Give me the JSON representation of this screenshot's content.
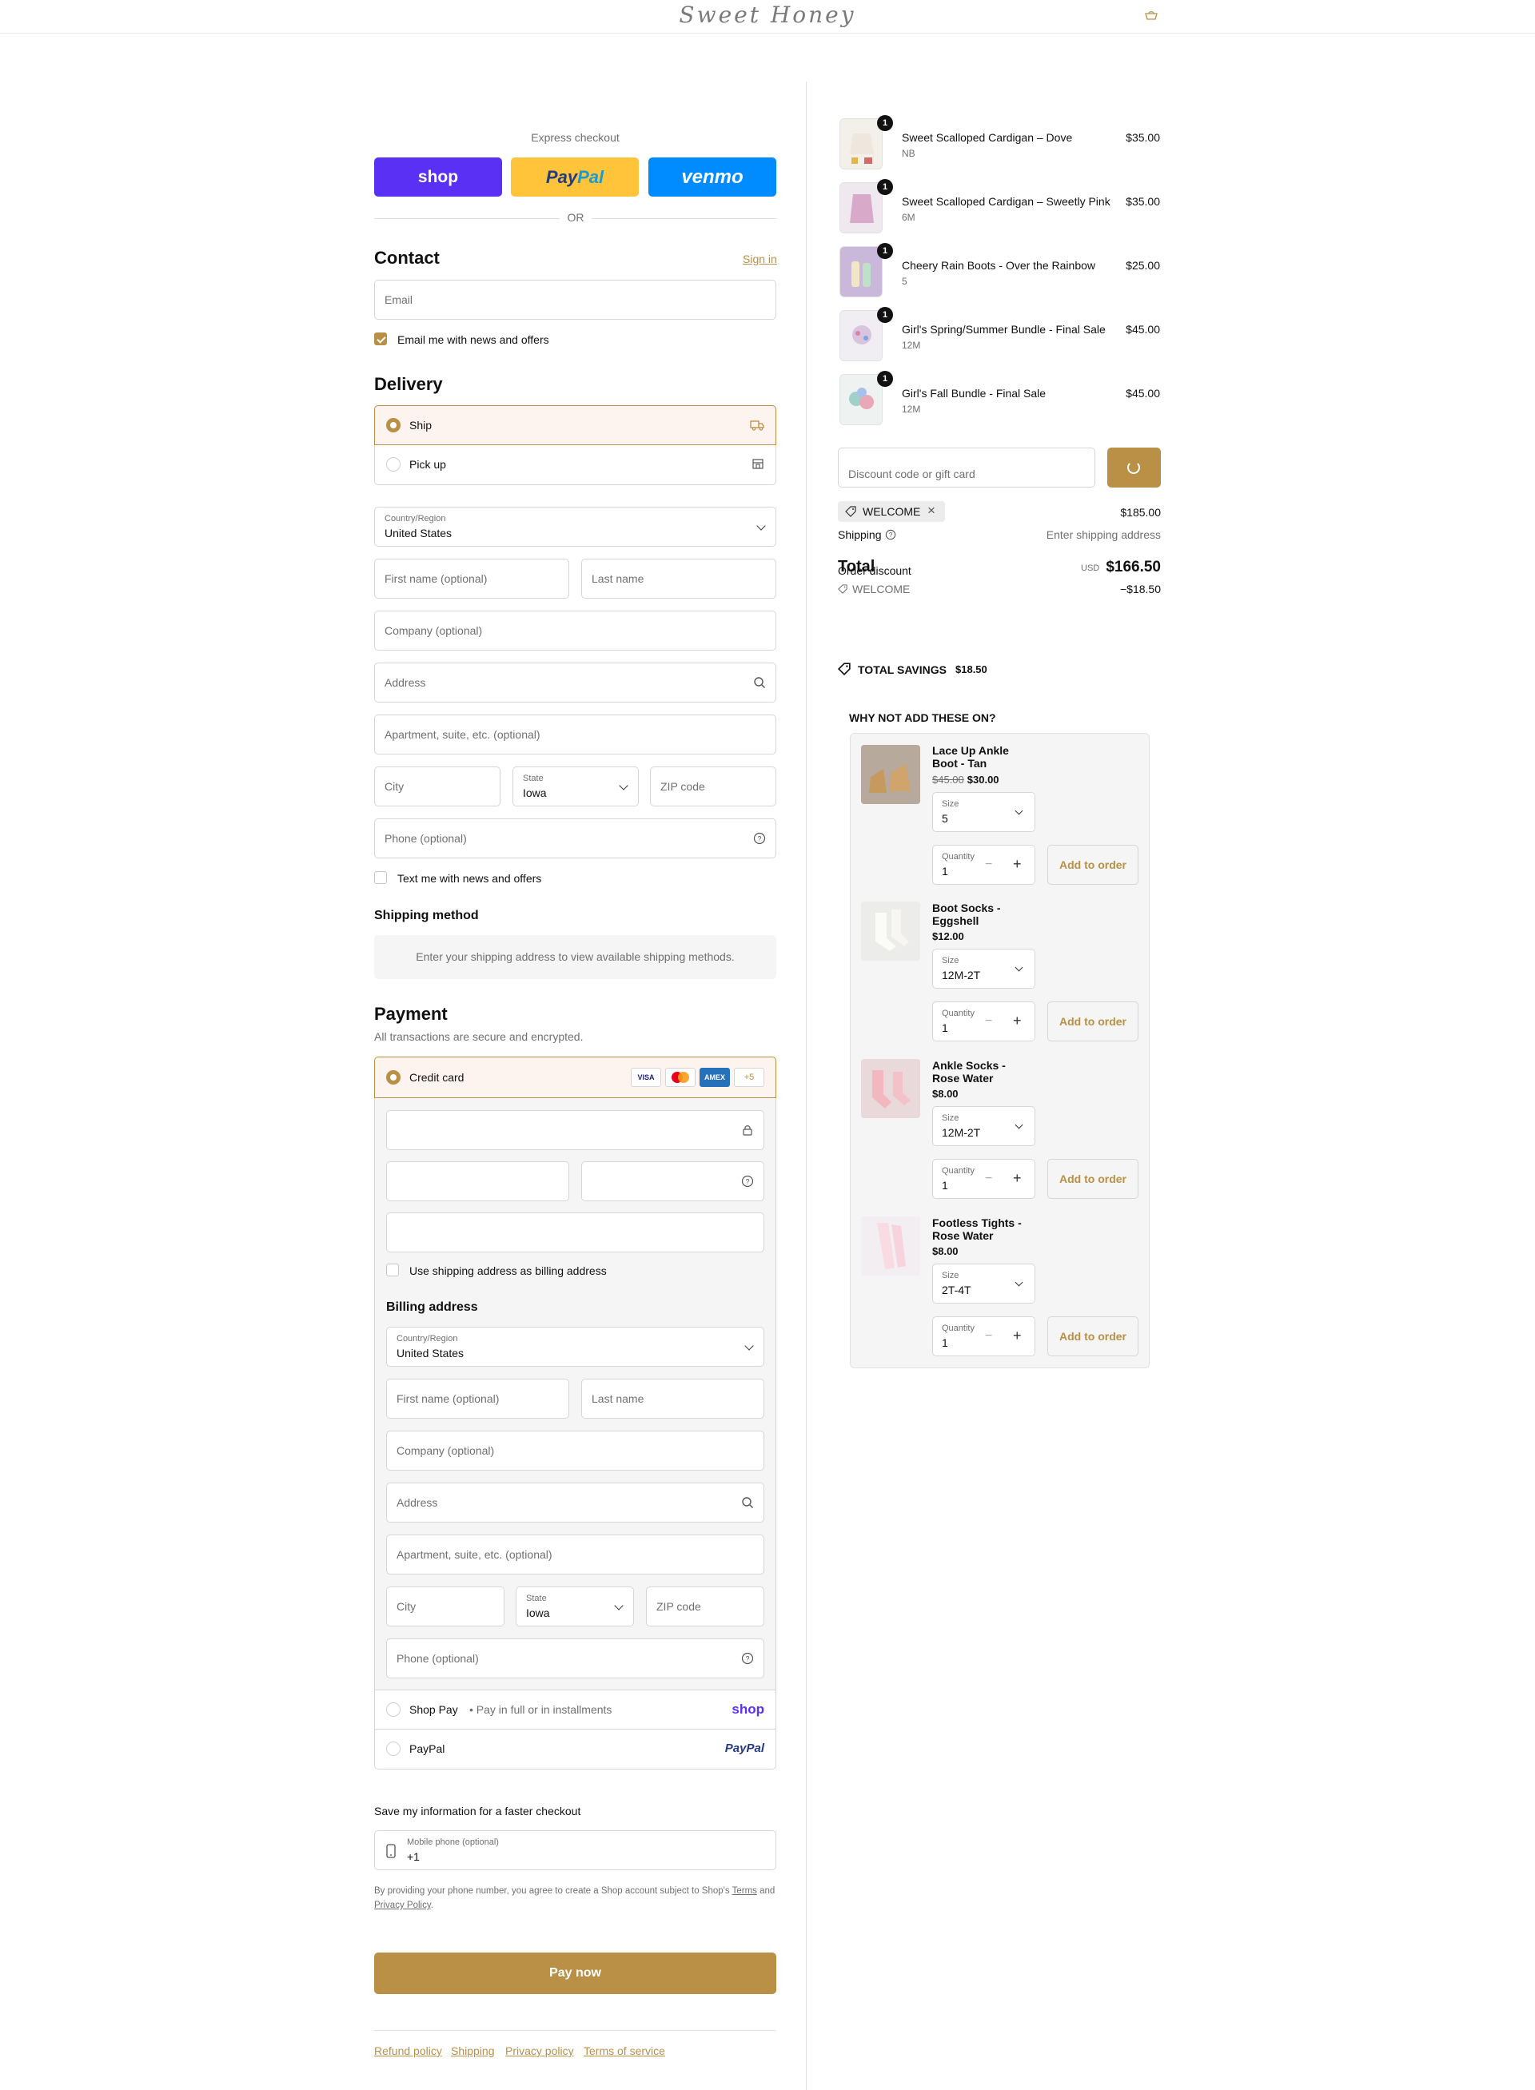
{
  "header": {
    "logo": "Sweet Honey"
  },
  "express": {
    "label": "Express checkout",
    "shop": "shop",
    "paypal_a": "Pay",
    "paypal_b": "Pal",
    "venmo": "venmo",
    "or": "OR"
  },
  "contact": {
    "title": "Contact",
    "sign_in": "Sign in",
    "email_placeholder": "Email",
    "news_label": "Email me with news and offers"
  },
  "delivery": {
    "title": "Delivery",
    "ship": "Ship",
    "pickup": "Pick up",
    "country_label": "Country/Region",
    "country": "United States",
    "first_name": "First name (optional)",
    "last_name": "Last name",
    "company": "Company (optional)",
    "address": "Address",
    "apartment": "Apartment, suite, etc. (optional)",
    "city": "City",
    "state_label": "State",
    "state": "Iowa",
    "zip": "ZIP code",
    "phone": "Phone (optional)",
    "text_label": "Text me with news and offers"
  },
  "shipping_method": {
    "title": "Shipping method",
    "message": "Enter your shipping address to view available shipping methods."
  },
  "payment": {
    "title": "Payment",
    "subtitle": "All transactions are secure and encrypted.",
    "credit_card": "Credit card",
    "card_brands": [
      "VISA",
      "MC",
      "AMEX"
    ],
    "more_brands": "+5",
    "use_shipping": "Use shipping address as billing address",
    "billing_title": "Billing address",
    "country_label": "Country/Region",
    "country": "United States",
    "first_name": "First name (optional)",
    "last_name": "Last name",
    "company": "Company (optional)",
    "address": "Address",
    "apartment": "Apartment, suite, etc. (optional)",
    "city": "City",
    "state_label": "State",
    "state": "Iowa",
    "zip": "ZIP code",
    "phone": "Phone (optional)",
    "shop_pay": "Shop Pay",
    "shop_pay_sub": "• Pay in full or in installments",
    "shop_pay_logo": "shop",
    "paypal": "PayPal",
    "paypal_logo": "PayPal"
  },
  "save_info": {
    "title": "Save my information for a faster checkout",
    "mobile_label": "Mobile phone (optional)",
    "mobile_value": "+1",
    "legal_1": "By providing your phone number, you agree to create a Shop account subject to Shop's",
    "terms": "Terms",
    "legal_and": "and",
    "privacy": "Privacy Policy",
    "legal_end": "."
  },
  "pay_now": "Pay now",
  "footer_links": [
    "Refund policy",
    "Shipping",
    "Privacy policy",
    "Terms of service"
  ],
  "cart": {
    "items": [
      {
        "qty": "1",
        "name": "Sweet Scalloped Cardigan – Dove",
        "variant": "NB",
        "price": "$35.00"
      },
      {
        "qty": "1",
        "name": "Sweet Scalloped Cardigan – Sweetly Pink",
        "variant": "6M",
        "price": "$35.00"
      },
      {
        "qty": "1",
        "name": "Cheery Rain Boots - Over the Rainbow",
        "variant": "5",
        "price": "$25.00"
      },
      {
        "qty": "1",
        "name": "Girl's Spring/Summer Bundle - Final Sale",
        "variant": "12M",
        "price": "$45.00"
      },
      {
        "qty": "1",
        "name": "Girl's Fall Bundle - Final Sale",
        "variant": "12M",
        "price": "$45.00"
      }
    ],
    "discount_placeholder": "Discount code or gift card",
    "applied_code": "WELCOME",
    "subtotal": "$185.00",
    "shipping_label": "Shipping",
    "shipping_value": "Enter shipping address",
    "order_discount": "Order discount",
    "total_label": "Total",
    "discount_code": "WELCOME",
    "discount_value": "−$18.50",
    "currency": "USD",
    "total": "$166.50",
    "savings_label": "TOTAL SAVINGS",
    "savings_value": "$18.50"
  },
  "upsell": {
    "title": "WHY NOT ADD THESE ON?",
    "size_label": "Size",
    "quantity_label": "Quantity",
    "add_label": "Add to order",
    "products": [
      {
        "name": "Lace Up Ankle Boot - Tan",
        "old_price": "$45.00",
        "price": "$30.00",
        "size": "5",
        "qty": "1"
      },
      {
        "name": "Boot Socks - Eggshell",
        "old_price": "",
        "price": "$12.00",
        "size": "12M-2T",
        "qty": "1"
      },
      {
        "name": "Ankle Socks - Rose Water",
        "old_price": "",
        "price": "$8.00",
        "size": "12M-2T",
        "qty": "1"
      },
      {
        "name": "Footless Tights - Rose Water",
        "old_price": "",
        "price": "$8.00",
        "size": "2T-4T",
        "qty": "1"
      }
    ]
  }
}
